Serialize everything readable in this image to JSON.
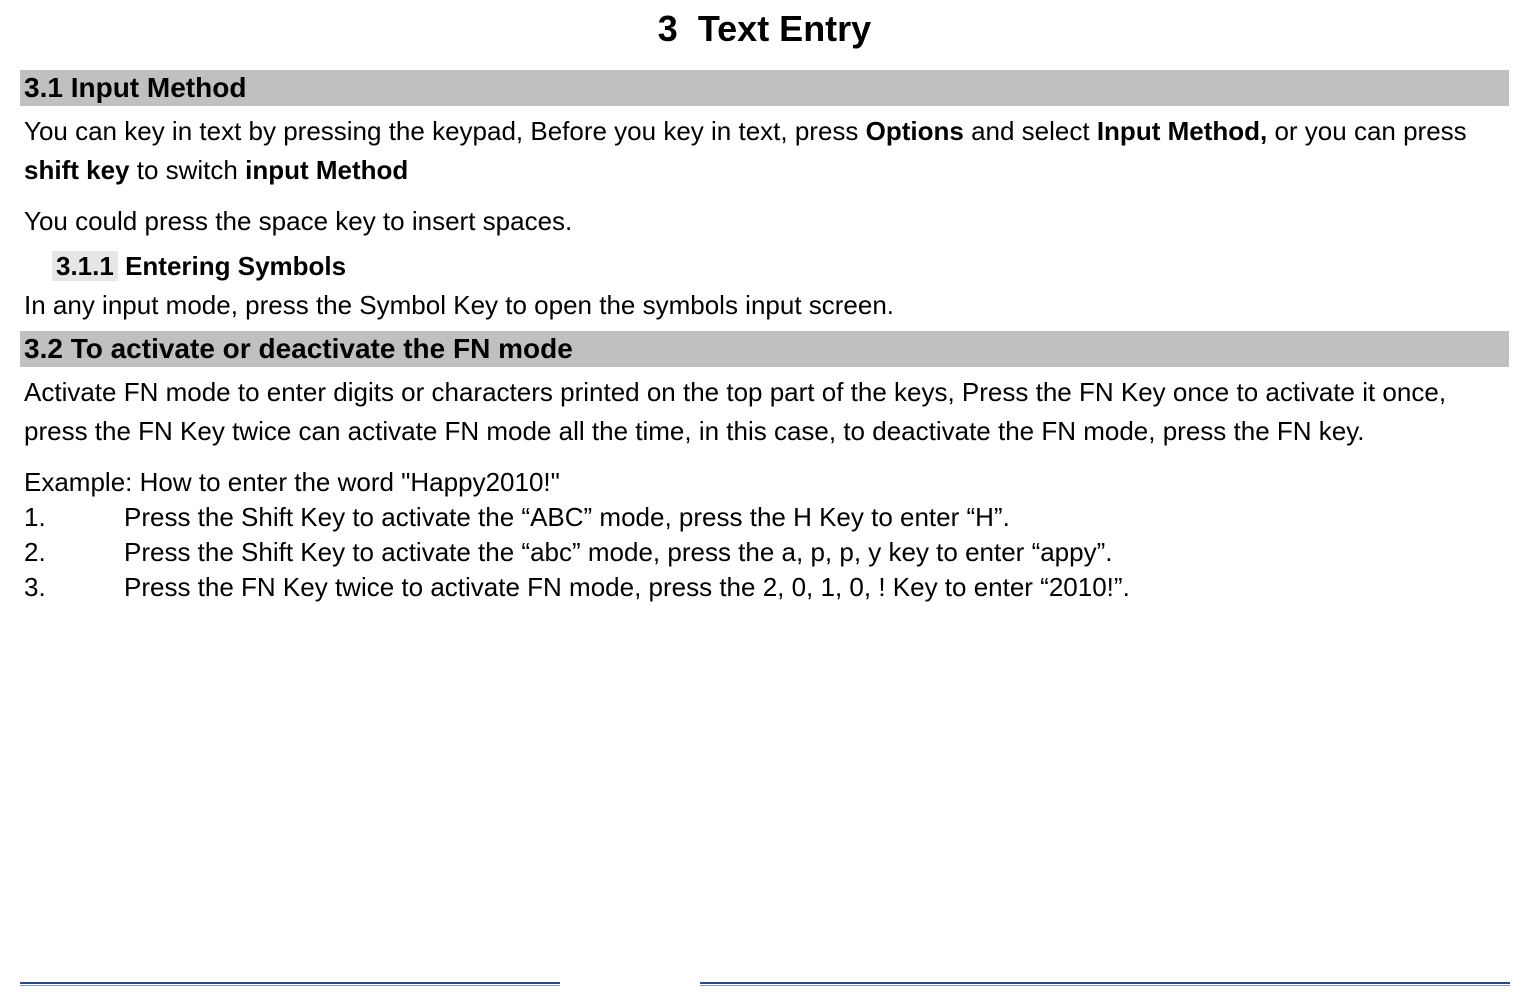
{
  "chapter": {
    "number": "3",
    "title": "Text Entry"
  },
  "section31": {
    "heading": "3.1 Input Method",
    "para1_parts": {
      "p1": "You can key in text by pressing the keypad, Before you key in text, press ",
      "b1": "Options",
      "p2": " and select ",
      "b2": "Input Method,",
      "p3": " or you can press ",
      "b3": "shift key",
      "p4": " to switch ",
      "b4": "input Method"
    },
    "para2": "You could press the space key to insert spaces."
  },
  "section311": {
    "number": "3.1.1",
    "title": "Entering Symbols",
    "para": "In any input mode, press the Symbol Key to open the symbols input screen."
  },
  "section32": {
    "heading": "3.2 To activate or deactivate the FN mode",
    "para1": "Activate FN mode to enter digits or characters printed on the top part of the keys, Press the FN Key once to activate it once, press the FN Key twice can activate FN mode all the time, in this case, to deactivate the FN mode, press the FN key.",
    "example_intro": "Example: How to enter the word \"Happy2010!\"",
    "steps": [
      {
        "num": "1.",
        "text": "Press the Shift Key to activate the “ABC” mode, press the H Key to enter “H”."
      },
      {
        "num": "2.",
        "text": "Press the Shift Key to activate the “abc” mode, press the a, p, p, y key to enter “appy”."
      },
      {
        "num": "3.",
        "text": "Press the FN Key twice to activate FN mode, press the 2, 0, 1, 0, ! Key to enter “2010!”."
      }
    ]
  }
}
